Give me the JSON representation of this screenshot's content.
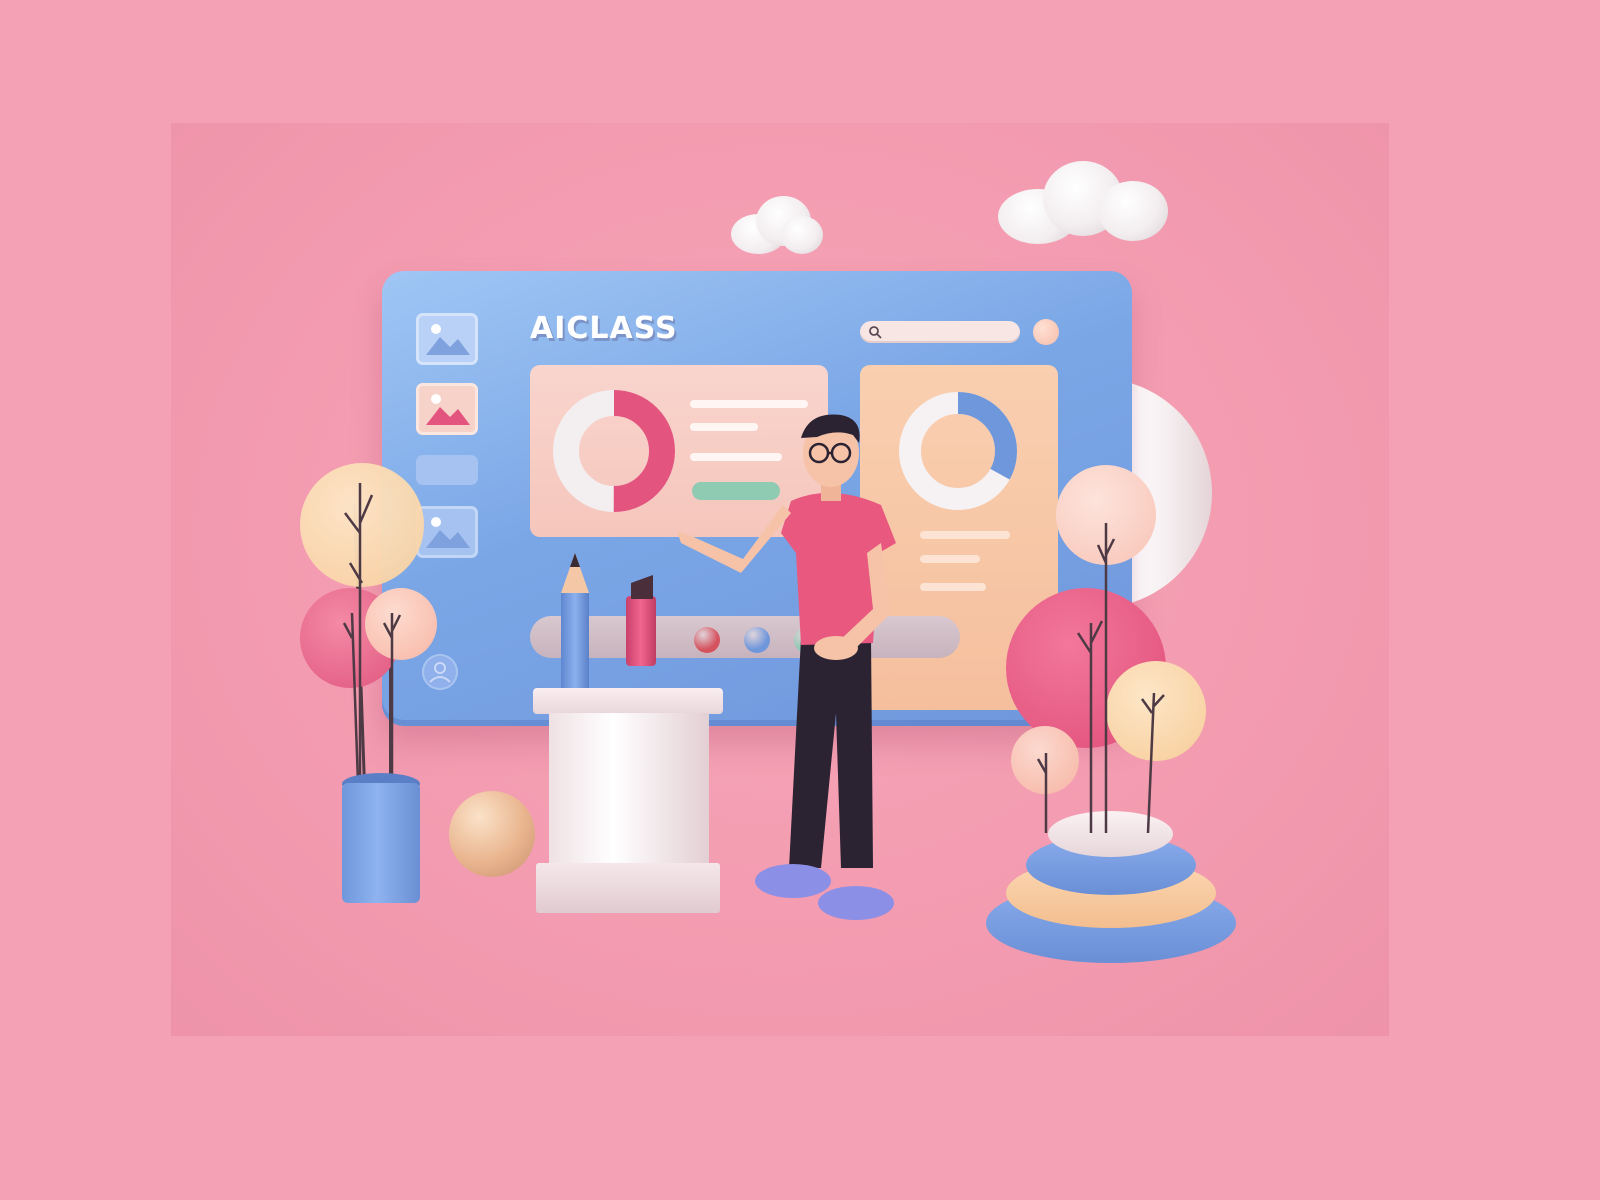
{
  "app": {
    "brand_label": "AICLASS"
  },
  "search": {
    "icon": "search-icon"
  },
  "colors": {
    "background": "#f4a0b5",
    "monitor": "#7aa6e6",
    "card_left": "#f7cfc5",
    "card_right": "#f7c6a6",
    "accent_pink": "#e3557f",
    "accent_blue": "#6f97dc",
    "accent_green": "#8fcab3",
    "accent_red": "#d5535f",
    "shirt": "#e8587f",
    "pants": "#2b2232"
  },
  "sidebar": {
    "items": [
      {
        "icon": "image-icon"
      },
      {
        "icon": "image-icon"
      },
      {
        "icon": "blank-tile"
      },
      {
        "icon": "image-icon"
      },
      {
        "icon": "user-icon"
      }
    ]
  },
  "charts": {
    "left_donut": {
      "filled_fraction": 0.5,
      "color": "#e3557f"
    },
    "right_donut": {
      "filled_fraction": 0.33,
      "color": "#6f97dc"
    }
  },
  "color_dots": [
    "#d5535f",
    "#6f97dc",
    "#8fcab3"
  ]
}
